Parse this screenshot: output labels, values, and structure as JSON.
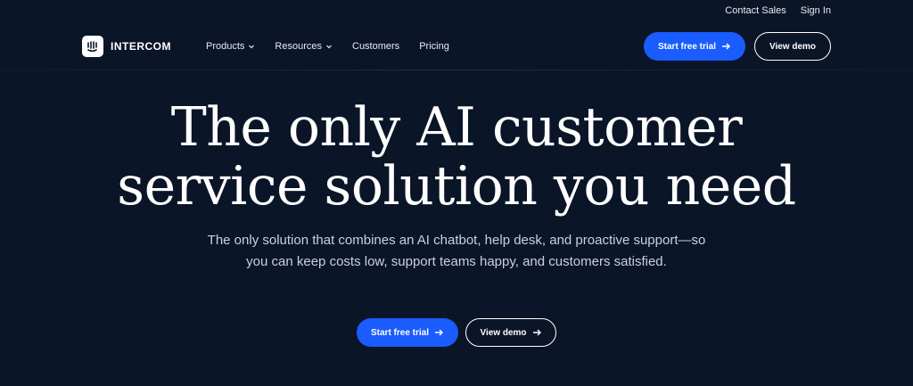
{
  "utility": {
    "contact_sales": "Contact Sales",
    "sign_in": "Sign In"
  },
  "brand": {
    "name": "INTERCOM",
    "icon": "intercom-logo-icon"
  },
  "nav": {
    "items": [
      {
        "label": "Products",
        "dropdown": true
      },
      {
        "label": "Resources",
        "dropdown": true
      },
      {
        "label": "Customers",
        "dropdown": false
      },
      {
        "label": "Pricing",
        "dropdown": false
      }
    ],
    "start_trial": "Start free trial",
    "view_demo": "View demo"
  },
  "hero": {
    "title_line1": "The only AI customer",
    "title_line2": "service solution you need",
    "subtitle": "The only solution that combines an AI chatbot, help desk, and proactive support—so you can keep costs low, support teams happy, and customers satisfied.",
    "start_trial": "Start free trial",
    "view_demo": "View demo"
  },
  "colors": {
    "background": "#0b1528",
    "primary": "#1a5cff",
    "text": "#ffffff",
    "muted": "#c9d1de"
  }
}
